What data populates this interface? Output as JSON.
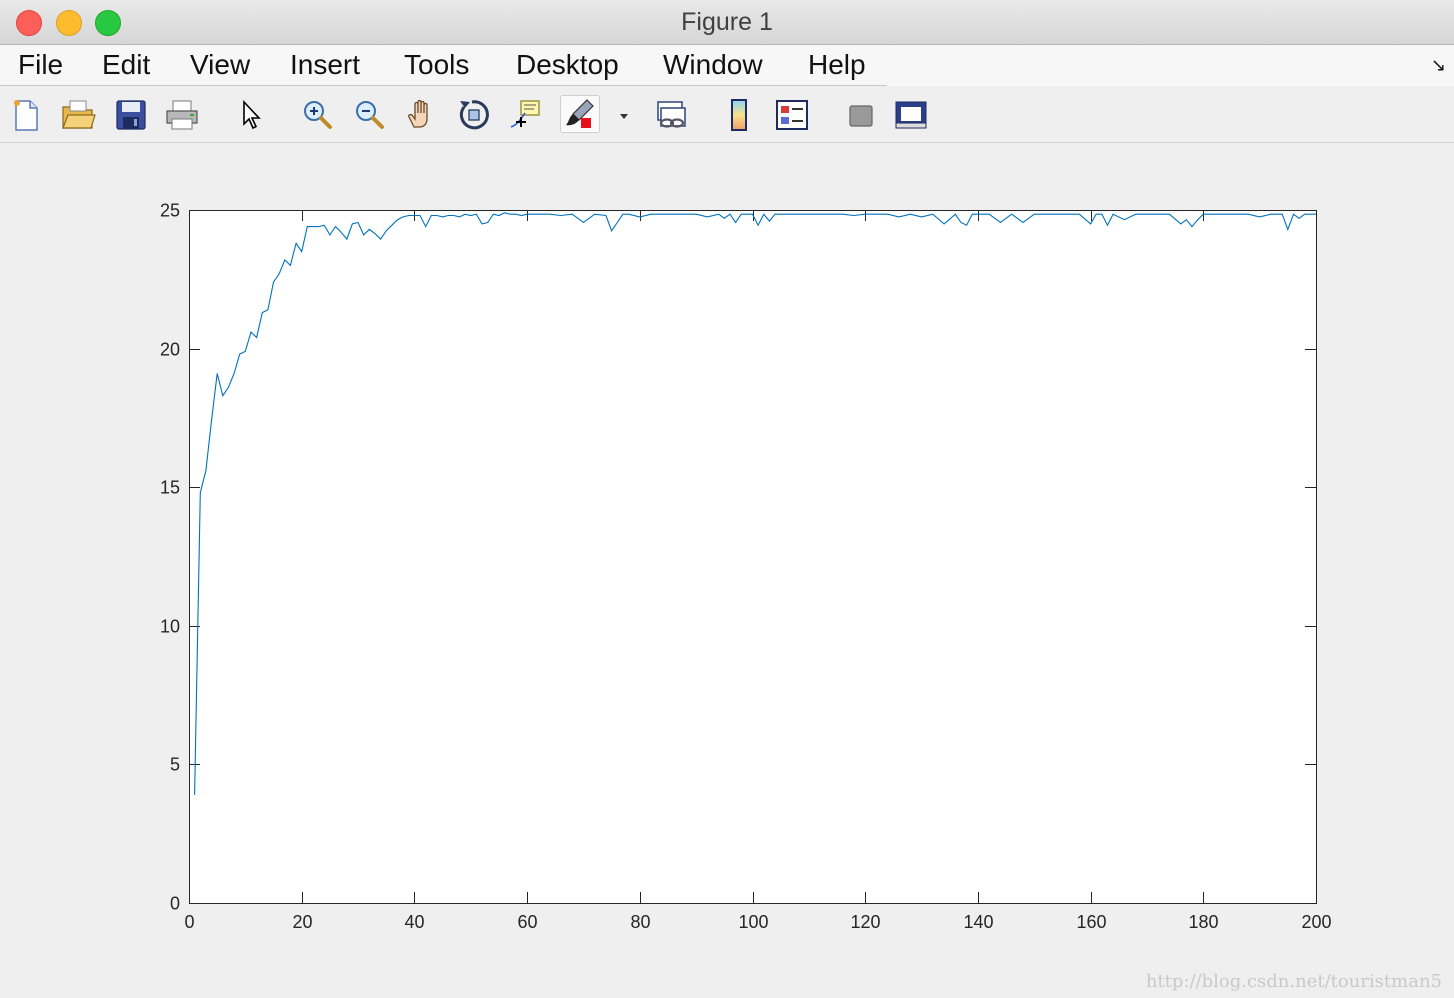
{
  "window": {
    "title": "Figure 1"
  },
  "menu": [
    "File",
    "Edit",
    "View",
    "Insert",
    "Tools",
    "Desktop",
    "Window",
    "Help"
  ],
  "toolbar": {
    "icons": [
      "new-figure-icon",
      "open-file-icon",
      "save-icon",
      "print-icon",
      "edit-plot-arrow-icon",
      "zoom-in-icon",
      "zoom-out-icon",
      "pan-hand-icon",
      "rotate-3d-icon",
      "data-cursor-icon",
      "brush-icon",
      "brush-dropdown-icon",
      "link-plot-icon",
      "colorbar-icon",
      "legend-icon",
      "hide-plot-tools-icon",
      "show-plot-tools-icon"
    ]
  },
  "colors": {
    "line": "#0072bd"
  },
  "watermark": "http://blog.csdn.net/touristman5",
  "chart_data": {
    "type": "line",
    "title": "",
    "xlabel": "",
    "ylabel": "",
    "xlim": [
      0,
      200
    ],
    "ylim": [
      0,
      25
    ],
    "xticks": [
      0,
      20,
      40,
      60,
      80,
      100,
      120,
      140,
      160,
      180,
      200
    ],
    "yticks": [
      0,
      5,
      10,
      15,
      20,
      25
    ],
    "grid": false,
    "series": [
      {
        "x": [
          1,
          2,
          3,
          4,
          5,
          6,
          7,
          8,
          9,
          10,
          11,
          12,
          13,
          14,
          15,
          16,
          17,
          18,
          19,
          20,
          21,
          22,
          23,
          24,
          25,
          26,
          27,
          28,
          29,
          30,
          31,
          32,
          33,
          34,
          35,
          36,
          37,
          38,
          39,
          40,
          41,
          42,
          43,
          44,
          45,
          46,
          47,
          48,
          49,
          50,
          51,
          52,
          53,
          54,
          55,
          56,
          57,
          58,
          59,
          60,
          62,
          64,
          66,
          68,
          70,
          72,
          74,
          75,
          76,
          77,
          78,
          80,
          82,
          84,
          86,
          88,
          90,
          92,
          94,
          95,
          96,
          97,
          98,
          100,
          101,
          102,
          103,
          104,
          106,
          108,
          110,
          112,
          114,
          116,
          118,
          120,
          122,
          124,
          126,
          128,
          130,
          132,
          134,
          136,
          137,
          138,
          139,
          140,
          142,
          144,
          146,
          148,
          150,
          152,
          154,
          156,
          158,
          160,
          161,
          162,
          163,
          164,
          166,
          168,
          170,
          172,
          174,
          176,
          177,
          178,
          179,
          180,
          182,
          184,
          186,
          188,
          190,
          192,
          194,
          195,
          196,
          197,
          198,
          200
        ],
        "values": [
          3.9,
          14.8,
          15.6,
          17.4,
          19.1,
          18.3,
          18.6,
          19.1,
          19.8,
          19.9,
          20.6,
          20.4,
          21.3,
          21.4,
          22.4,
          22.7,
          23.2,
          23.0,
          23.8,
          23.5,
          24.4,
          24.4,
          24.4,
          24.45,
          24.1,
          24.4,
          24.2,
          23.95,
          24.5,
          24.55,
          24.1,
          24.3,
          24.15,
          23.95,
          24.25,
          24.45,
          24.65,
          24.75,
          24.8,
          24.8,
          24.8,
          24.4,
          24.8,
          24.8,
          24.75,
          24.8,
          24.8,
          24.75,
          24.85,
          24.8,
          24.85,
          24.5,
          24.55,
          24.85,
          24.8,
          24.9,
          24.85,
          24.85,
          24.8,
          24.85,
          24.85,
          24.85,
          24.8,
          24.85,
          24.55,
          24.85,
          24.8,
          24.25,
          24.55,
          24.85,
          24.85,
          24.75,
          24.85,
          24.85,
          24.85,
          24.85,
          24.85,
          24.75,
          24.85,
          24.7,
          24.85,
          24.55,
          24.85,
          24.85,
          24.45,
          24.85,
          24.6,
          24.85,
          24.85,
          24.85,
          24.85,
          24.85,
          24.85,
          24.85,
          24.8,
          24.85,
          24.85,
          24.85,
          24.75,
          24.85,
          24.75,
          24.85,
          24.5,
          24.85,
          24.55,
          24.45,
          24.85,
          24.85,
          24.85,
          24.55,
          24.85,
          24.55,
          24.85,
          24.85,
          24.85,
          24.85,
          24.85,
          24.5,
          24.85,
          24.85,
          24.45,
          24.85,
          24.65,
          24.85,
          24.85,
          24.85,
          24.85,
          24.5,
          24.65,
          24.4,
          24.65,
          24.85,
          24.85,
          24.85,
          24.85,
          24.85,
          24.75,
          24.85,
          24.85,
          24.3,
          24.85,
          24.7,
          24.85,
          24.85
        ]
      }
    ]
  }
}
